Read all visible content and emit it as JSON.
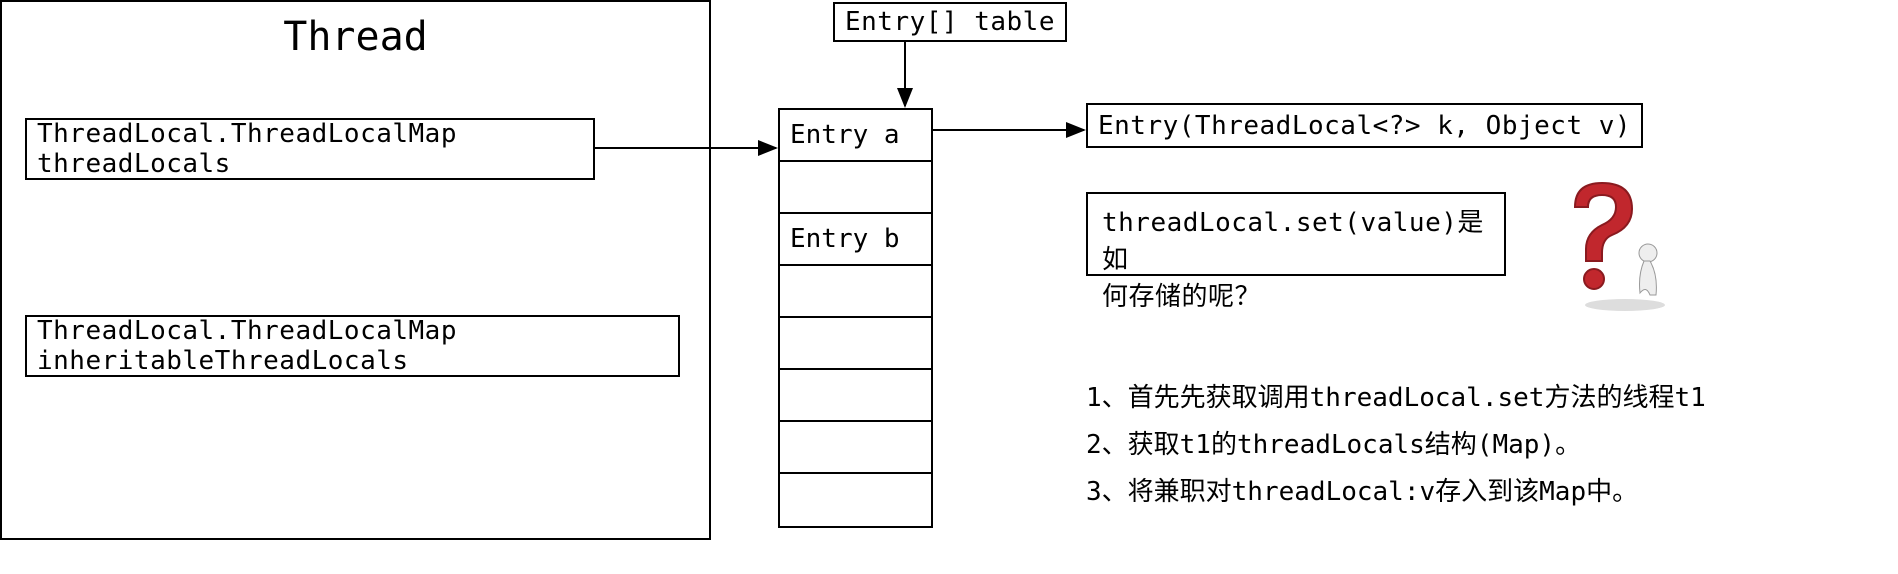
{
  "thread": {
    "title": "Thread",
    "field1": "ThreadLocal.ThreadLocalMap threadLocals",
    "field2": "ThreadLocal.ThreadLocalMap  inheritableThreadLocals"
  },
  "table": {
    "label": "Entry[] table",
    "cells": [
      "Entry a",
      "",
      "Entry b",
      "",
      "",
      "",
      "",
      ""
    ]
  },
  "entry_constructor": "Entry(ThreadLocal<?> k, Object v)",
  "question": {
    "line1": "threadLocal.set(value)是如",
    "line2": "何存储的呢？"
  },
  "steps": {
    "s1": "1、首先先获取调用threadLocal.set方法的线程t1",
    "s2": "2、获取t1的threadLocals结构(Map)。",
    "s3": "3、将兼职对threadLocal:v存入到该Map中。"
  }
}
